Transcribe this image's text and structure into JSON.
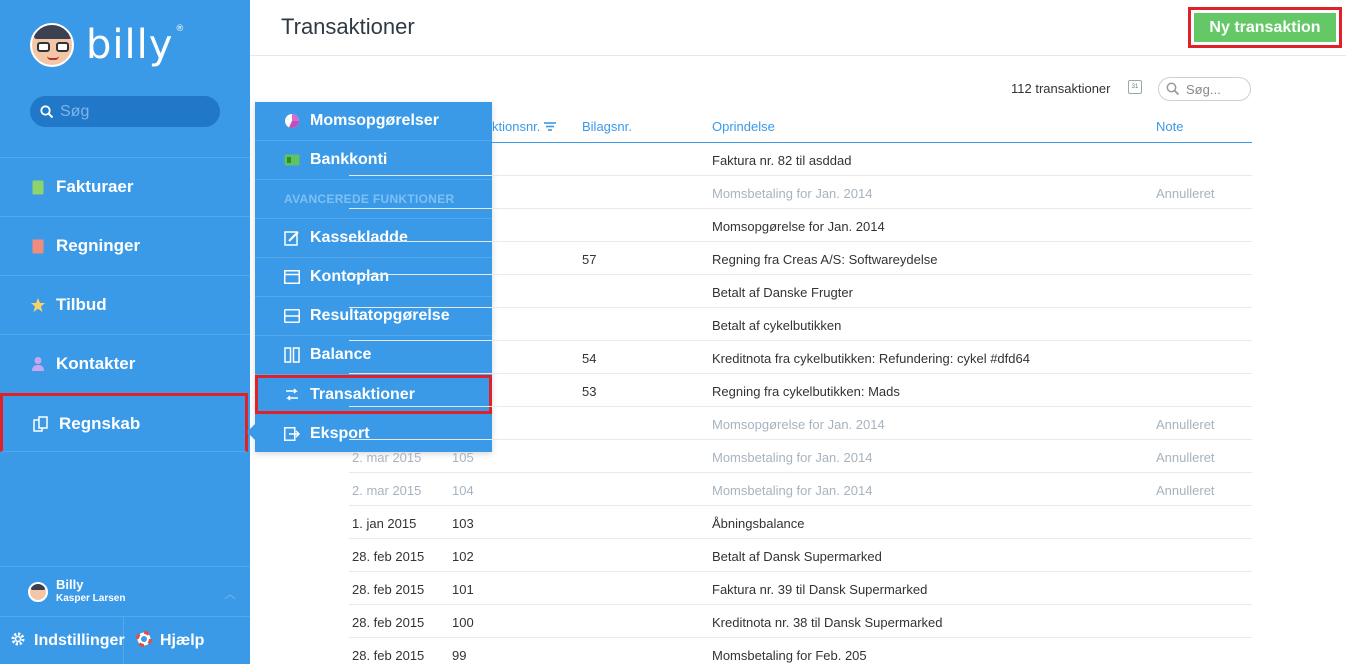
{
  "app": {
    "logo_text": "billy",
    "logo_mark": "®"
  },
  "sidebar": {
    "search_placeholder": "Søg",
    "items": [
      {
        "label": "Fakturaer",
        "icon": "invoice-icon",
        "color": "#8ed36b"
      },
      {
        "label": "Regninger",
        "icon": "bill-icon",
        "color": "#f08c7c"
      },
      {
        "label": "Tilbud",
        "icon": "star-icon",
        "color": "#f5d36a"
      },
      {
        "label": "Kontakter",
        "icon": "person-icon",
        "color": "#c9a7f0"
      },
      {
        "label": "Regnskab",
        "icon": "ledger-icon",
        "color": "#ffffff"
      }
    ],
    "user": {
      "name": "Billy",
      "company": "Kasper Larsen"
    },
    "settings_label": "Indstillinger",
    "help_label": "Hjælp"
  },
  "popover": {
    "items_top": [
      {
        "label": "Momsopgørelser",
        "icon": "pie-chart-icon"
      },
      {
        "label": "Bankkonti",
        "icon": "bank-card-icon"
      }
    ],
    "heading": "AVANCEREDE FUNKTIONER",
    "items_advanced": [
      {
        "label": "Kassekladde",
        "icon": "notebook-icon"
      },
      {
        "label": "Kontoplan",
        "icon": "chart-of-accounts-icon"
      },
      {
        "label": "Resultatopgørelse",
        "icon": "income-statement-icon"
      },
      {
        "label": "Balance",
        "icon": "balance-icon"
      },
      {
        "label": "Transaktioner",
        "icon": "transactions-icon"
      },
      {
        "label": "Eksport",
        "icon": "export-icon"
      }
    ]
  },
  "header": {
    "title": "Transaktioner",
    "new_button": "Ny transaktion"
  },
  "toolbar": {
    "count": "112 transaktioner",
    "calendar_label": "31",
    "search_placeholder": "Søg..."
  },
  "table": {
    "headers": {
      "no": "Transaktionsnr.",
      "bilag": "Bilagsnr.",
      "origin": "Oprindelse",
      "note": "Note"
    },
    "rows": [
      {
        "date": "",
        "no": "",
        "bilag": "",
        "origin": "Faktura nr. 82 til asddad",
        "note": "",
        "voided": false
      },
      {
        "date": "",
        "no": "",
        "bilag": "",
        "origin": "Momsbetaling for Jan. 2014",
        "note": "Annulleret",
        "voided": true
      },
      {
        "date": "",
        "no": "",
        "bilag": "",
        "origin": "Momsopgørelse for Jan. 2014",
        "note": "",
        "voided": false
      },
      {
        "date": "",
        "no": "",
        "bilag": "57",
        "origin": "Regning fra Creas A/S: Softwareydelse",
        "note": "",
        "voided": false
      },
      {
        "date": "",
        "no": "",
        "bilag": "",
        "origin": "Betalt af Danske Frugter",
        "note": "",
        "voided": false
      },
      {
        "date": "",
        "no": "",
        "bilag": "",
        "origin": "Betalt af cykelbutikken",
        "note": "",
        "voided": false
      },
      {
        "date": "",
        "no": "",
        "bilag": "54",
        "origin": "Kreditnota fra cykelbutikken: Refundering: cykel #dfd64",
        "note": "",
        "voided": false
      },
      {
        "date": "",
        "no": "",
        "bilag": "53",
        "origin": "Regning fra cykelbutikken: Mads",
        "note": "",
        "voided": false
      },
      {
        "date": "",
        "no": "",
        "bilag": "",
        "origin": "Momsopgørelse for Jan. 2014",
        "note": "Annulleret",
        "voided": true
      },
      {
        "date": "2. mar 2015",
        "no": "105",
        "bilag": "",
        "origin": "Momsbetaling for Jan. 2014",
        "note": "Annulleret",
        "voided": true
      },
      {
        "date": "2. mar 2015",
        "no": "104",
        "bilag": "",
        "origin": "Momsbetaling for Jan. 2014",
        "note": "Annulleret",
        "voided": true
      },
      {
        "date": "1. jan 2015",
        "no": "103",
        "bilag": "",
        "origin": "Åbningsbalance",
        "note": "",
        "voided": false
      },
      {
        "date": "28. feb 2015",
        "no": "102",
        "bilag": "",
        "origin": "Betalt af Dansk Supermarked",
        "note": "",
        "voided": false
      },
      {
        "date": "28. feb 2015",
        "no": "101",
        "bilag": "",
        "origin": "Faktura nr. 39 til Dansk Supermarked",
        "note": "",
        "voided": false
      },
      {
        "date": "28. feb 2015",
        "no": "100",
        "bilag": "",
        "origin": "Kreditnota nr. 38 til Dansk Supermarked",
        "note": "",
        "voided": false
      },
      {
        "date": "28. feb 2015",
        "no": "99",
        "bilag": "",
        "origin": "Momsbetaling for Feb. 205",
        "note": "",
        "voided": false
      }
    ]
  },
  "colors": {
    "sidebar": "#3a9ae8",
    "accent": "#3a9ae8",
    "primary_button": "#64c867",
    "highlight": "#e02128",
    "voided_text": "#a7b3bf"
  }
}
